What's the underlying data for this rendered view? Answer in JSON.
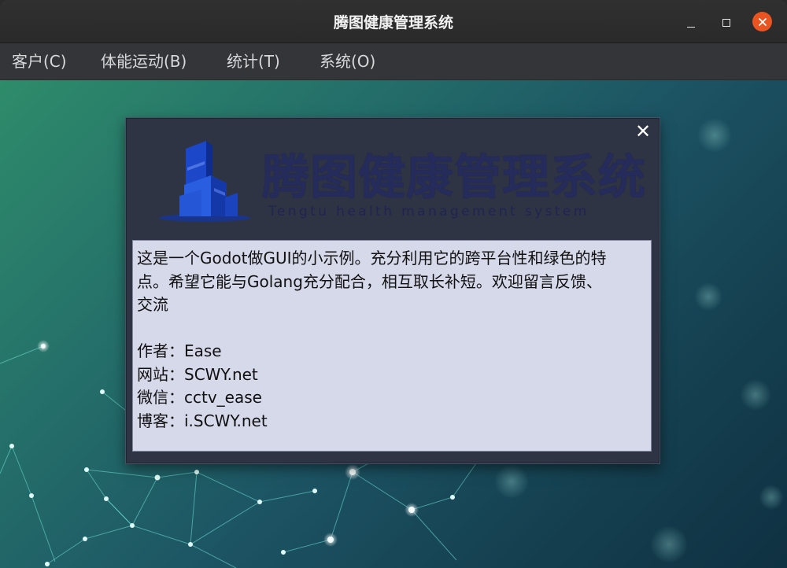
{
  "window": {
    "title": "腾图健康管理系统",
    "close_color": "#e95420"
  },
  "menu": {
    "items": [
      {
        "label": "客户(C)"
      },
      {
        "label": "体能运动(B)"
      },
      {
        "label": "统计(T)"
      },
      {
        "label": "系统(O)"
      }
    ]
  },
  "dialog": {
    "close_glyph": "✕",
    "logo": {
      "title": "腾图健康管理系统",
      "subtitle": "Tengtu health management system",
      "mark_icon": "building-logo-icon"
    },
    "content": {
      "lines": [
        "这是一个Godot做GUI的小示例。充分利用它的跨平台性和绿色的特",
        "点。希望它能与Golang充分配合，相互取长补短。欢迎留言反馈、",
        "交流",
        "",
        "作者：Ease",
        "网站：SCWY.net",
        "微信：cctv_ease",
        "博客：i.SCWY.net"
      ]
    }
  },
  "colors": {
    "accent": "#e95420",
    "textbox_bg": "#d5d9ea",
    "dialog_bg": "#2e3444"
  }
}
